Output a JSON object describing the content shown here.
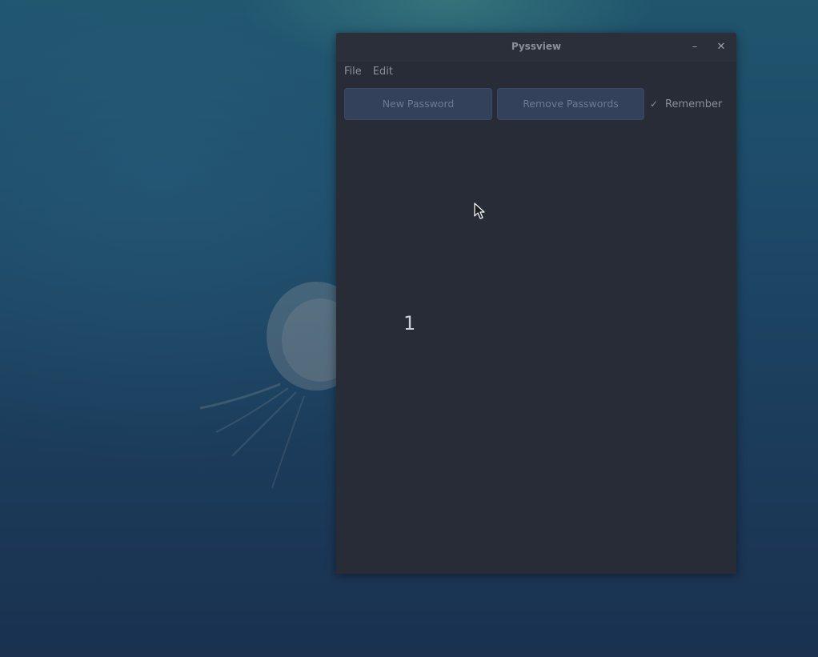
{
  "window": {
    "title": "Pyssview",
    "minimize_glyph": "–",
    "close_glyph": "✕"
  },
  "menu": {
    "items": [
      {
        "label": "File"
      },
      {
        "label": "Edit"
      }
    ]
  },
  "toolbar": {
    "new_password_label": "New Password",
    "remove_passwords_label": "Remove Passwords",
    "remember_label": "Remember",
    "remember_checked": true,
    "check_glyph": "✓"
  },
  "content": {
    "count_text": "1"
  },
  "colors": {
    "window_bg": "#282c37",
    "button_bg": "#34415b",
    "text_muted": "#8a8f9c"
  },
  "icons": {
    "minimize": "minimize-icon",
    "close": "close-icon",
    "check": "check-icon",
    "cursor": "mouse-cursor-icon"
  }
}
